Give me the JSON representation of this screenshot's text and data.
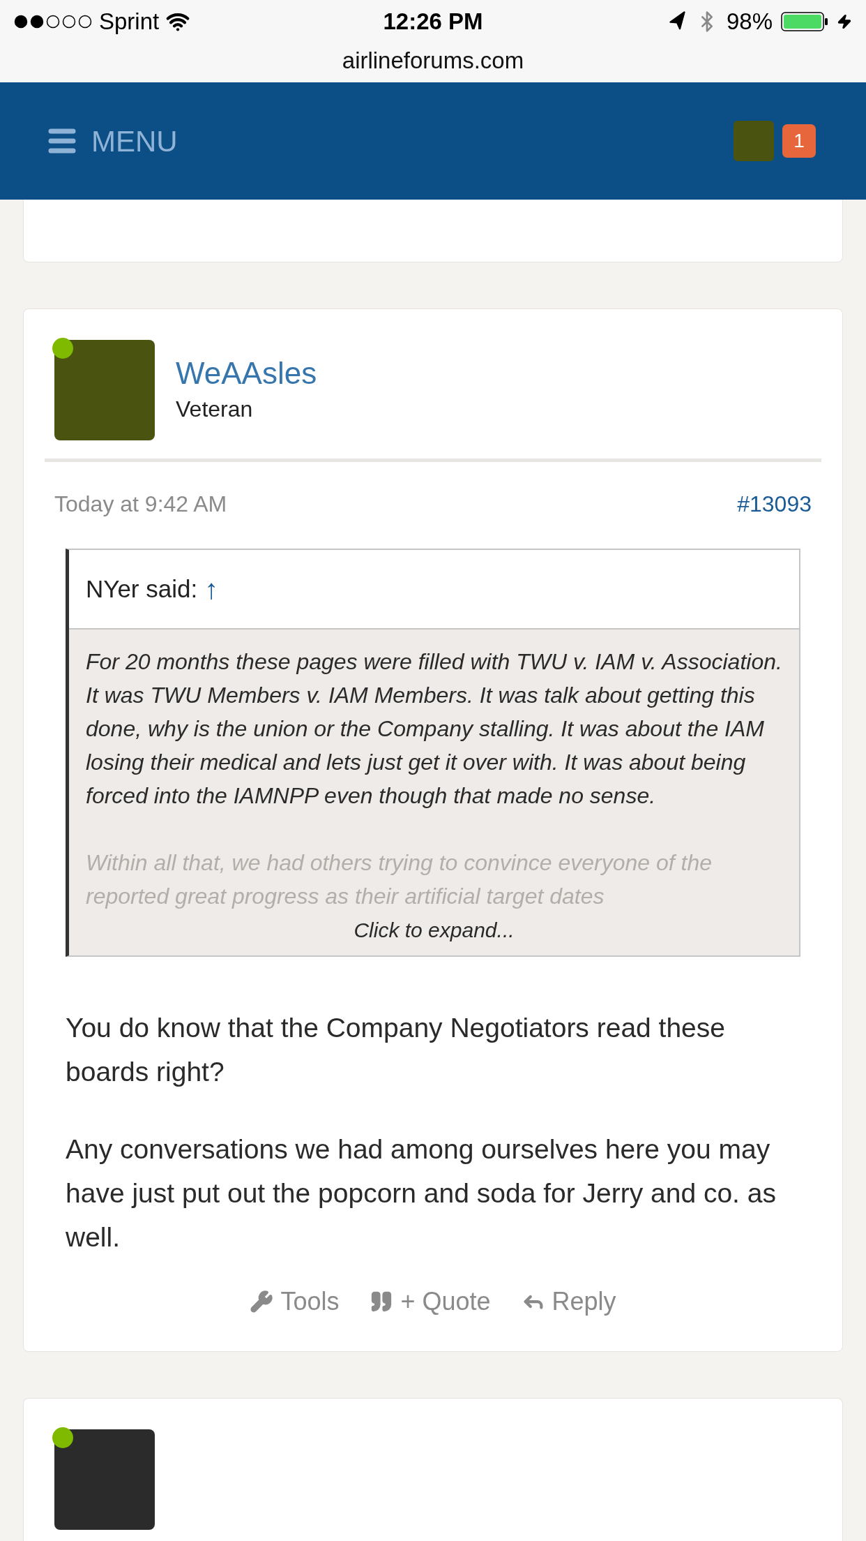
{
  "status_bar": {
    "carrier": "Sprint",
    "time": "12:26 PM",
    "battery": "98%",
    "url": "airlineforums.com"
  },
  "header": {
    "menu_label": "MENU",
    "notification_count": "1"
  },
  "post": {
    "author": {
      "name": "WeAAsles",
      "title": "Veteran",
      "online": true
    },
    "date": "Today at 9:42 AM",
    "post_number": "#13093",
    "quote": {
      "attribution": "NYer said:",
      "jump_link": "↑",
      "paragraphs": [
        "For 20 months these pages were filled with TWU v. IAM v. Association. It was TWU Members v. IAM Members. It was talk about getting this done, why is the union or the Company stalling. It was about the IAM losing their medical and lets just get it over with. It was about being forced into the IAMNPP even though that made no sense."
      ],
      "faded_paragraph": "Within all that, we had others trying to convince everyone of the reported great progress as their artificial target dates",
      "expand_label": "Click to expand..."
    },
    "message": [
      "You do know that the Company Negotiators read these boards right?",
      "Any conversations we had among ourselves here you may have just put out the popcorn and soda for Jerry and co. as well."
    ],
    "actions": [
      {
        "kind": "tools",
        "label": "Tools"
      },
      {
        "kind": "quote",
        "label": "+ Quote"
      },
      {
        "kind": "reply",
        "label": "Reply"
      }
    ]
  },
  "next_post": {
    "author": {
      "online": true
    }
  }
}
